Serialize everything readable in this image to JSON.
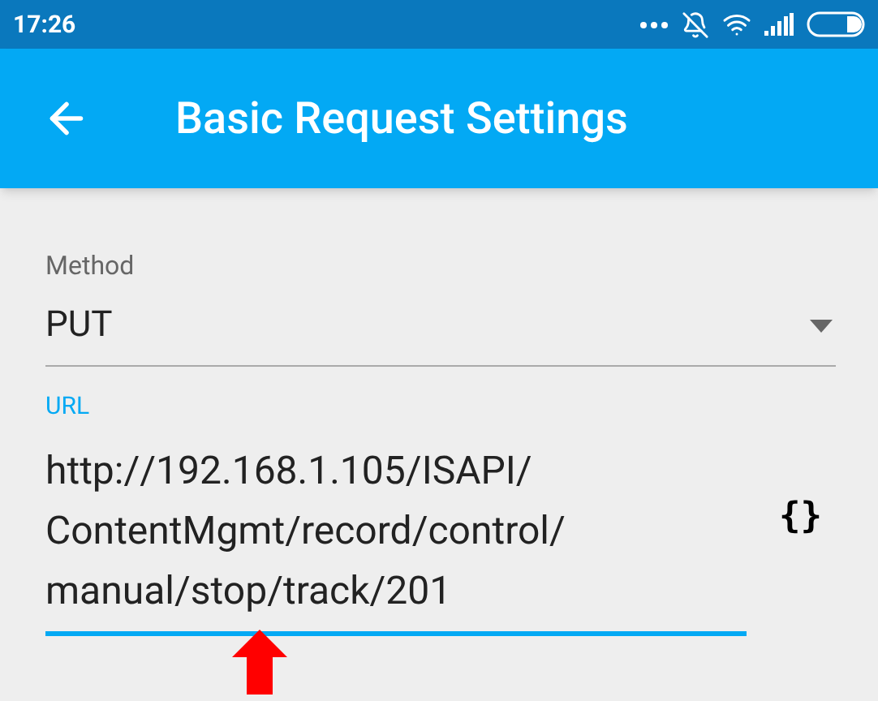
{
  "status_bar": {
    "time": "17:26"
  },
  "app_bar": {
    "title": "Basic Request Settings"
  },
  "method": {
    "label": "Method",
    "value": "PUT"
  },
  "url": {
    "label": "URL",
    "value": "http://192.168.1.105/ISAPI/ContentMgmt/record/control/manual/stop/track/201",
    "focused": true,
    "insert_button": "{}"
  }
}
